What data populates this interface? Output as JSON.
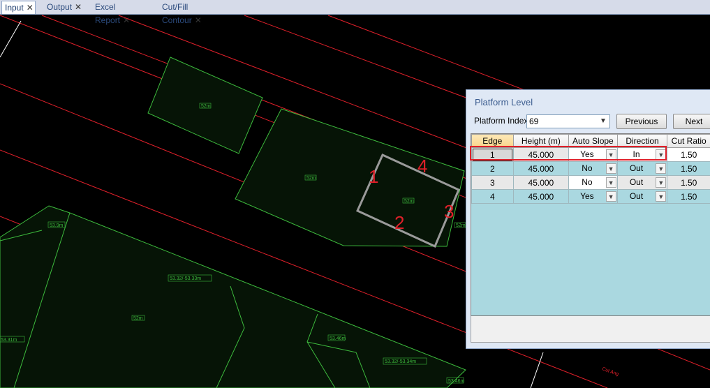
{
  "tabs": [
    {
      "label": "Input",
      "active": true
    },
    {
      "label": "Output",
      "active": false
    },
    {
      "label": "Excel Report",
      "active": false
    },
    {
      "label": "Cut/Fill Contour",
      "active": false
    }
  ],
  "close_glyph": "✕",
  "cad": {
    "edge_numbers": [
      "1",
      "2",
      "3",
      "4"
    ],
    "labels": [
      "52m",
      "52m",
      "52m",
      "52m",
      "53.9m",
      "53.32/-53.33m",
      "52m",
      "53.31m",
      "53.46m",
      "53.32/-53.34m",
      "53.46m",
      "Cut Ang"
    ]
  },
  "panel": {
    "title": "Platform Level",
    "platform_index_label": "Platform Index",
    "platform_index_value": "69",
    "previous_label": "Previous",
    "next_label": "Next",
    "columns": [
      "Edge",
      "Height (m)",
      "Auto Slope",
      "Direction",
      "Cut Ratio"
    ],
    "rows": [
      {
        "edge": "1",
        "height": "45.000",
        "auto_slope": "Yes",
        "direction": "In",
        "cut_ratio": "1.50"
      },
      {
        "edge": "2",
        "height": "45.000",
        "auto_slope": "No",
        "direction": "Out",
        "cut_ratio": "1.50"
      },
      {
        "edge": "3",
        "height": "45.000",
        "auto_slope": "No",
        "direction": "Out",
        "cut_ratio": "1.50"
      },
      {
        "edge": "4",
        "height": "45.000",
        "auto_slope": "Yes",
        "direction": "Out",
        "cut_ratio": "1.50"
      }
    ],
    "dropdown_glyph": "▼"
  },
  "colors": {
    "red_lines": "#e0202a",
    "parcel_lines": "#3dbb3d",
    "platform_outline": "#9a9a9a",
    "grid_blue": "#aad8e0"
  }
}
